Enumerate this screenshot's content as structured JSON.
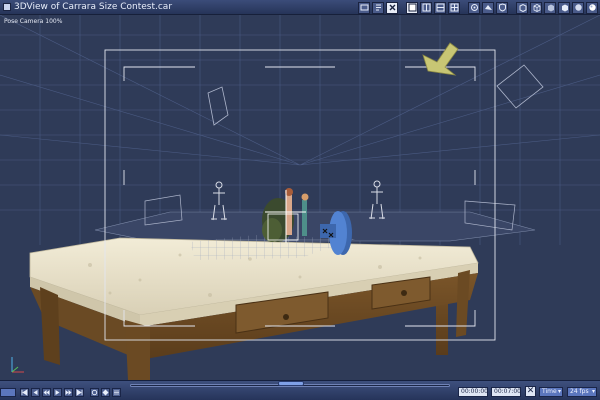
{
  "window": {
    "title": "3DView of Carrara Size Contest.car"
  },
  "titlebar_tools": [
    {
      "name": "view-window-icon"
    },
    {
      "name": "script-icon"
    },
    {
      "name": "delete-icon"
    },
    {
      "name": "layout-single-icon"
    },
    {
      "name": "layout-two-icon"
    },
    {
      "name": "layout-split-icon"
    },
    {
      "name": "layout-quad-icon"
    },
    {
      "name": "camera-view-icon"
    },
    {
      "name": "render-area-icon"
    },
    {
      "name": "shield-icon"
    },
    {
      "name": "bounding-box-icon"
    },
    {
      "name": "wireframe-icon"
    },
    {
      "name": "shaded-icon"
    },
    {
      "name": "textured-icon"
    },
    {
      "name": "smooth-shaded-icon"
    },
    {
      "name": "preview-sphere-icon"
    }
  ],
  "viewport": {
    "camera_label": "Pose Camera 100%"
  },
  "timeline": {
    "current_time": "00:00:00",
    "end_time": "00:07:00",
    "time_mode": "Time",
    "fps": "24 fps"
  },
  "colors": {
    "titlebar": "#2f3f6a",
    "viewport_bg": "#2f3b58",
    "grid": "#4a5a82",
    "frame": "#dfe3ee",
    "table_top": "#e9e2cc",
    "table_wood": "#6e4d26",
    "arrow": "#c9c873",
    "disc": "#4d7bc6"
  }
}
